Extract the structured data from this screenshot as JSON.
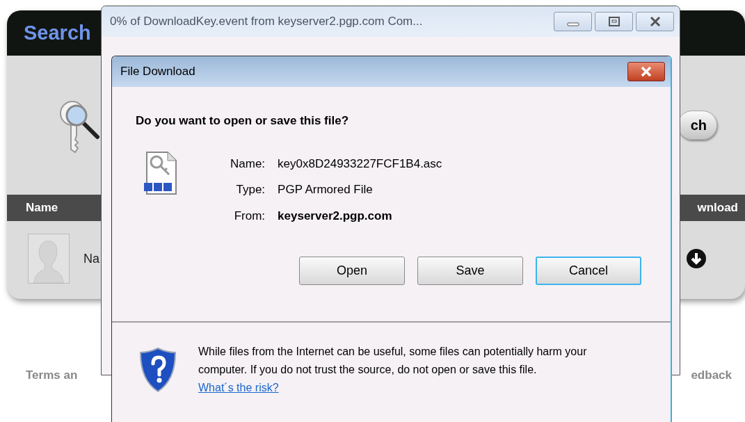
{
  "background_page": {
    "title": "Search",
    "search_button": "ch",
    "table": {
      "columns": [
        "Name",
        "wnload"
      ],
      "rows": [
        {
          "name": "Na"
        }
      ]
    },
    "footer": {
      "left_link": "Terms an",
      "right_link": "edback"
    }
  },
  "progress_window": {
    "title": "0% of DownloadKey.event from keyserver2.pgp.com Com..."
  },
  "dialog": {
    "title": "File Download",
    "question": "Do you want to open or save this file?",
    "fields": [
      {
        "label": "Name:",
        "value": "key0x8D24933227FCF1B4.asc",
        "bold": false
      },
      {
        "label": "Type:",
        "value": "PGP Armored File",
        "bold": false
      },
      {
        "label": "From:",
        "value": "keyserver2.pgp.com",
        "bold": true
      }
    ],
    "buttons": [
      {
        "label": "Open",
        "selected": false
      },
      {
        "label": "Save",
        "selected": false
      },
      {
        "label": "Cancel",
        "selected": true
      }
    ],
    "warning": {
      "text": "While files from the Internet can be useful, some files can potentially harm your computer. If you do not trust the source, do not open or save this file.",
      "link": "What´s the risk?"
    }
  }
}
